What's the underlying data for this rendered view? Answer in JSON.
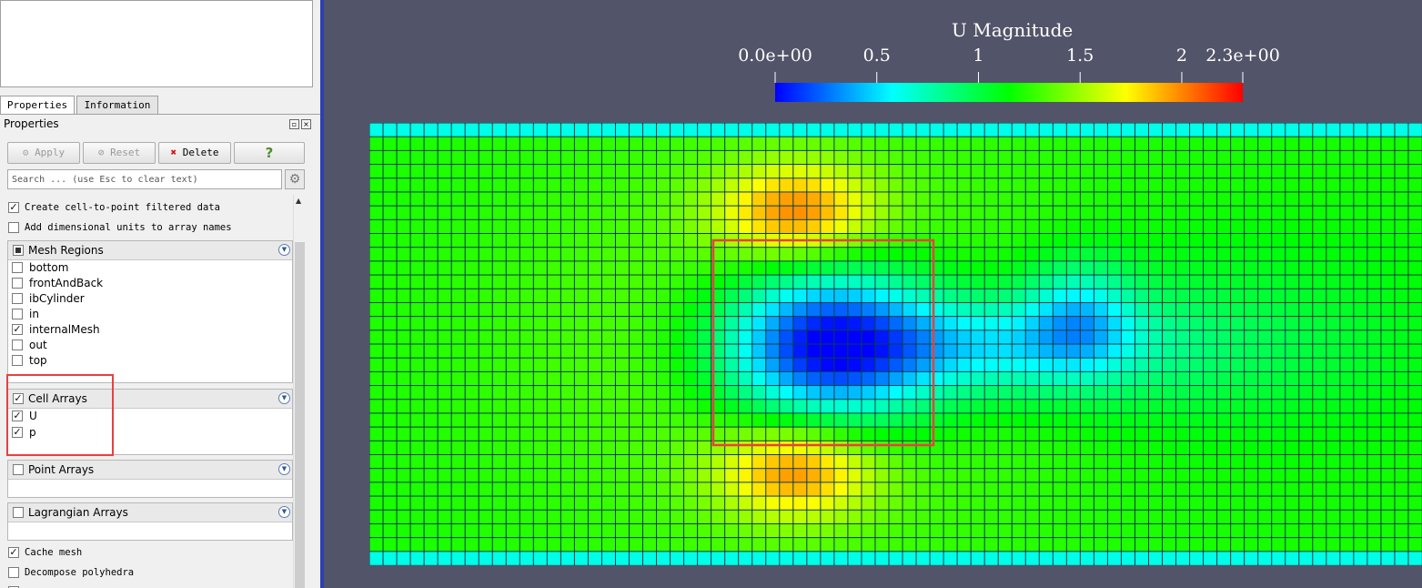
{
  "tabs": {
    "properties": "Properties",
    "information": "Information"
  },
  "panel": {
    "title": "Properties"
  },
  "toolbar": {
    "apply": "Apply",
    "reset": "Reset",
    "delete": "Delete",
    "help": "?"
  },
  "search": {
    "placeholder": "Search ... (use Esc to clear text)"
  },
  "options": {
    "create_cell_to_point": "Create cell-to-point filtered data",
    "add_dimensional_units": "Add dimensional units to array names",
    "cache_mesh": "Cache mesh",
    "decompose_polyhedra": "Decompose polyhedra"
  },
  "mesh_regions": {
    "title": "Mesh Regions",
    "items": [
      {
        "label": "bottom",
        "checked": false
      },
      {
        "label": "frontAndBack",
        "checked": false
      },
      {
        "label": "ibCylinder",
        "checked": false
      },
      {
        "label": "in",
        "checked": false
      },
      {
        "label": "internalMesh",
        "checked": true
      },
      {
        "label": "out",
        "checked": false
      },
      {
        "label": "top",
        "checked": false
      }
    ]
  },
  "cell_arrays": {
    "title": "Cell Arrays",
    "items": [
      {
        "label": "U",
        "checked": true
      },
      {
        "label": "p",
        "checked": true
      }
    ]
  },
  "point_arrays": {
    "title": "Point Arrays"
  },
  "lagrangian_arrays": {
    "title": "Lagrangian Arrays"
  },
  "colorbar": {
    "title": "U Magnitude",
    "ticks": [
      {
        "label": "0.0e+00",
        "value": 0
      },
      {
        "label": "0.5",
        "value": 0.5
      },
      {
        "label": "1",
        "value": 1
      },
      {
        "label": "1.5",
        "value": 1.5
      },
      {
        "label": "2",
        "value": 2
      },
      {
        "label": "2.3e+00",
        "value": 2.3
      }
    ],
    "range": [
      0,
      2.3
    ],
    "colors": [
      "#0000ff",
      "#00ffff",
      "#00ff00",
      "#ffff00",
      "#ff0000"
    ]
  },
  "colors": {
    "viewport_bg": "#525469",
    "highlight": "#e8413f",
    "grid_lines": "#0b3d4a"
  }
}
